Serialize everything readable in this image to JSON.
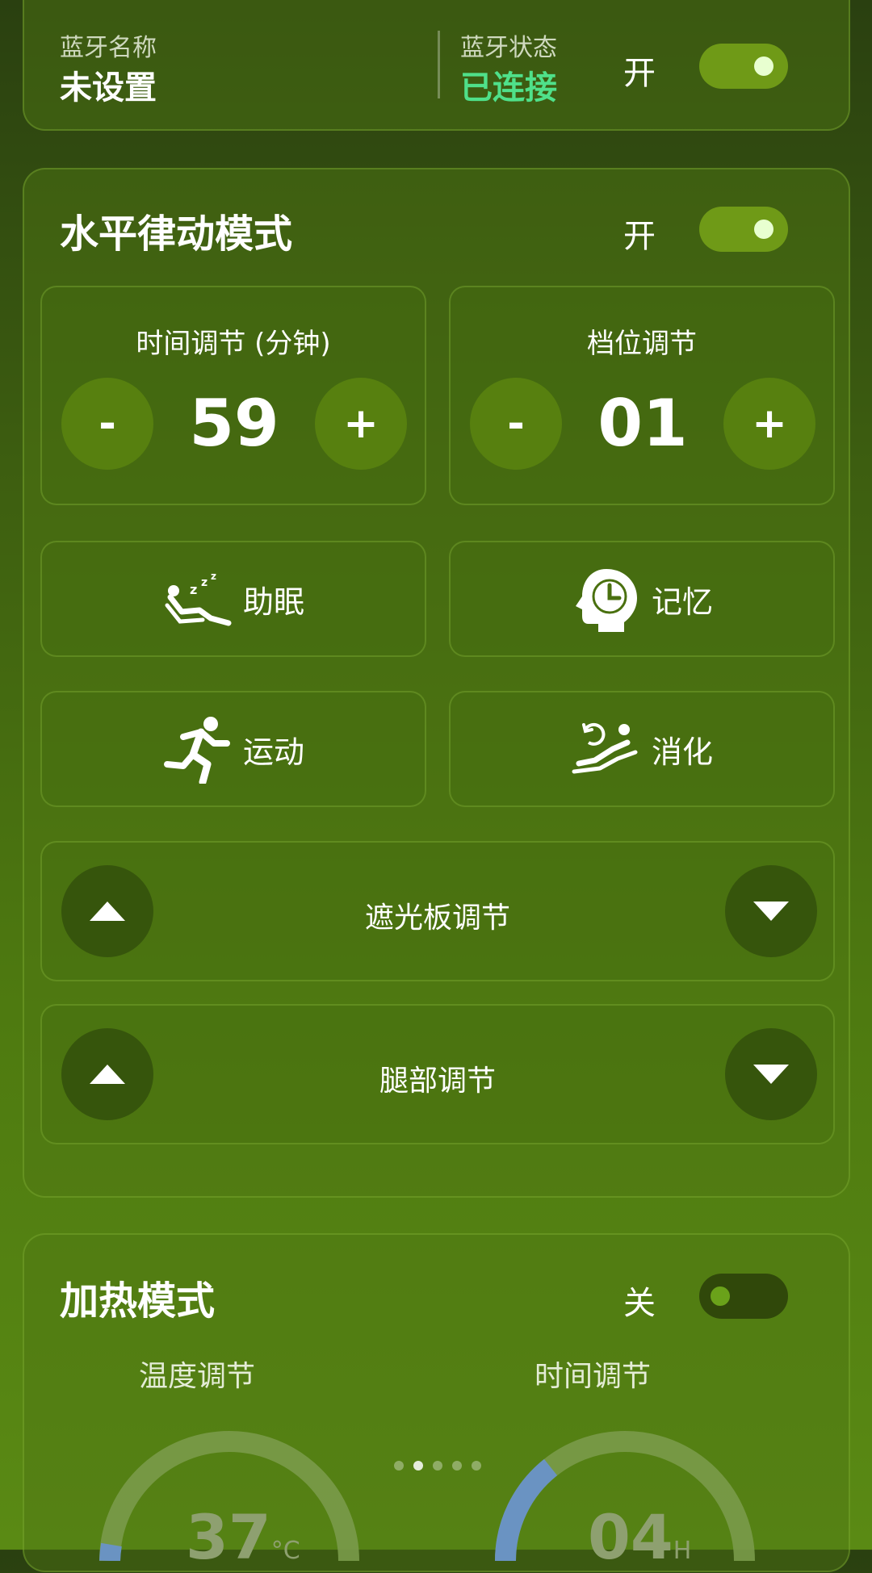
{
  "bluetooth": {
    "name_label": "蓝牙名称",
    "name_value": "未设置",
    "status_label": "蓝牙状态",
    "status_value": "已连接",
    "switch_label": "开",
    "switch_on": true
  },
  "rhythm_mode": {
    "title": "水平律动模式",
    "switch_label": "开",
    "switch_on": true,
    "time_adjust": {
      "label": "时间调节 (分钟)",
      "value": "59",
      "minus": "-",
      "plus": "+"
    },
    "gear_adjust": {
      "label": "档位调节",
      "value": "01",
      "minus": "-",
      "plus": "+"
    },
    "modes": [
      {
        "label": "助眠",
        "icon": "sleep-recline-icon"
      },
      {
        "label": "记忆",
        "icon": "memory-head-clock-icon"
      },
      {
        "label": "运动",
        "icon": "running-person-icon"
      },
      {
        "label": "消化",
        "icon": "digest-recline-icon"
      }
    ],
    "sunshade": {
      "label": "遮光板调节"
    },
    "leg": {
      "label": "腿部调节"
    }
  },
  "heating_mode": {
    "title": "加热模式",
    "switch_label": "关",
    "switch_on": false,
    "temp_label": "温度调节",
    "time_label": "时间调节",
    "temp_value": "37",
    "temp_unit": "°C",
    "time_value": "04",
    "time_unit": "H",
    "pager": {
      "count": 5,
      "active": 1
    }
  },
  "colors": {
    "accent_green": "#6f9a17",
    "connected_text": "#4fe08a",
    "dial_track": "#7a9a4a",
    "dial_progress": "#6a93c2"
  }
}
